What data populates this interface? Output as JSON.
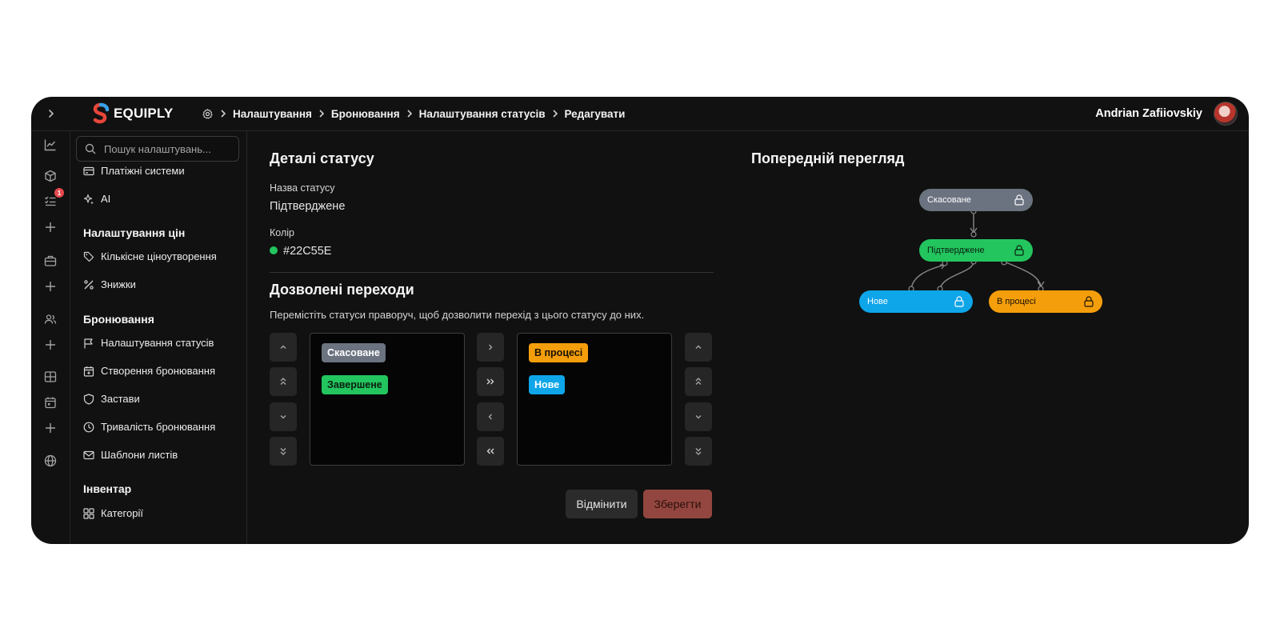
{
  "app": {
    "logo_text": "EQUIPLY",
    "breadcrumb": [
      "Налаштування",
      "Бронювання",
      "Налаштування статусів",
      "Редагувати"
    ],
    "user_name": "Andrian Zafiiovskiy",
    "rail_badge": "1"
  },
  "sidebar": {
    "search_placeholder": "Пошук налаштувань...",
    "top_items": [
      "Платіжні системи",
      "AI"
    ],
    "groups": [
      {
        "title": "Налаштування цін",
        "items": [
          "Кількісне ціноутворення",
          "Знижки"
        ]
      },
      {
        "title": "Бронювання",
        "items": [
          "Налаштування статусів",
          "Створення бронювання",
          "Застави",
          "Тривалість бронювання",
          "Шаблони листів"
        ]
      },
      {
        "title": "Інвентар",
        "items": [
          "Категорії"
        ]
      }
    ]
  },
  "details": {
    "title": "Деталі статусу",
    "name_label": "Назва статусу",
    "name_value": "Підтверджене",
    "color_label": "Колір",
    "color_value": "#22C55E"
  },
  "transitions": {
    "title": "Дозволені переходи",
    "description": "Перемістіть статуси праворуч, щоб дозволити перехід з цього статусу до них.",
    "available": [
      {
        "label": "Скасоване",
        "bg": "#6b7280",
        "fg": "#ffffff"
      },
      {
        "label": "Завершене",
        "bg": "#22c55e",
        "fg": "#0b1f10"
      }
    ],
    "allowed": [
      {
        "label": "В процесі",
        "bg": "#f59e0b",
        "fg": "#1a1204"
      },
      {
        "label": "Нове",
        "bg": "#0ea5e9",
        "fg": "#ffffff"
      }
    ]
  },
  "actions": {
    "cancel_label": "Відмінити",
    "save_label": "Зберегти"
  },
  "preview": {
    "title": "Попередній перегляд",
    "nodes": [
      {
        "label": "Скасоване",
        "bg": "#6b7280",
        "fg": "#ffffff"
      },
      {
        "label": "Підтверджене",
        "bg": "#22c55e",
        "fg": "#0b1f10"
      },
      {
        "label": "Нове",
        "bg": "#0ea5e9",
        "fg": "#ffffff"
      },
      {
        "label": "В процесі",
        "bg": "#f59e0b",
        "fg": "#1a1204"
      }
    ]
  }
}
